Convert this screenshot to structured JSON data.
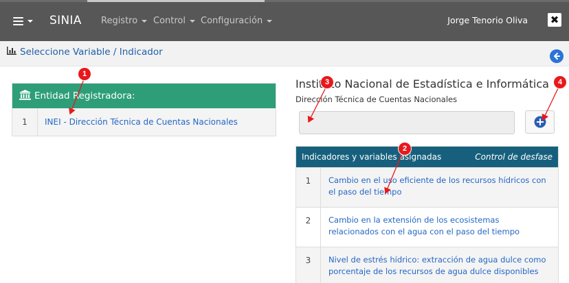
{
  "topbar": {
    "brand": "SINIA",
    "nav": [
      {
        "label": "Registro"
      },
      {
        "label": "Control"
      },
      {
        "label": "Configuración"
      }
    ],
    "user_name": "Jorge Tenorio Oliva",
    "close_glyph": "✖"
  },
  "subheader": {
    "title": "Seleccione Variable / Indicador",
    "title_icon": "bar-chart-icon",
    "back_icon": "arrow-left-circle-icon"
  },
  "entidad": {
    "header": "Entidad Registradora:",
    "header_icon": "institution-icon",
    "rows": [
      {
        "num": "1",
        "label": "INEI - Dirección Técnica de Cuentas Nacionales"
      }
    ]
  },
  "institution": {
    "title": "Instituto Nacional de Estadística e Informática",
    "subtitle": "Dirección Técnica de Cuentas Nacionales",
    "input_value": "",
    "add_icon": "plus-circle-icon"
  },
  "indicadores": {
    "header_left": "Indicadores y variables asignadas",
    "header_right": "Control de desfase",
    "rows": [
      {
        "num": "1",
        "label": "Cambio en el uso eficiente de los recursos hídricos con el paso del tiempo"
      },
      {
        "num": "2",
        "label": "Cambio en la extensión de los ecosistemas relacionados con el agua con el paso del tiempo"
      },
      {
        "num": "3",
        "label": "Nivel de estrés hídrico: extracción de agua dulce como porcentaje de los recursos de agua dulce disponibles"
      }
    ]
  },
  "annotations": {
    "badges": [
      "1",
      "2",
      "3",
      "4"
    ],
    "color": "#e8181b"
  },
  "colors": {
    "topbar": "#575757",
    "entidad_header": "#2e9e78",
    "indicadores_header": "#17607d",
    "link": "#2567c4"
  }
}
